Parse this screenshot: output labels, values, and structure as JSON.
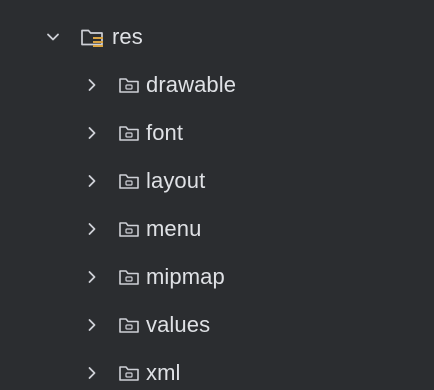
{
  "project_tree": {
    "root": {
      "label": "res",
      "expanded": true,
      "icon": "resource-folder-icon"
    },
    "children": [
      {
        "label": "drawable",
        "icon": "folder-icon",
        "expanded": false
      },
      {
        "label": "font",
        "icon": "folder-icon",
        "expanded": false
      },
      {
        "label": "layout",
        "icon": "folder-icon",
        "expanded": false
      },
      {
        "label": "menu",
        "icon": "folder-icon",
        "expanded": false
      },
      {
        "label": "mipmap",
        "icon": "folder-icon",
        "expanded": false
      },
      {
        "label": "values",
        "icon": "folder-icon",
        "expanded": false
      },
      {
        "label": "xml",
        "icon": "folder-icon",
        "expanded": false
      }
    ]
  },
  "colors": {
    "background": "#2b2d30",
    "text": "#dfe1e5",
    "icon_stroke": "#ced0d6",
    "resource_accent": "#d9a343"
  }
}
